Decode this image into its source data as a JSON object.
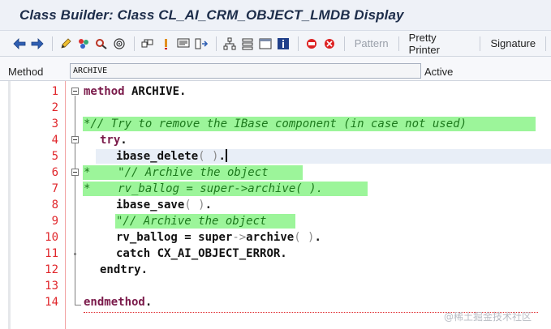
{
  "window": {
    "title": "Class Builder: Class CL_AI_CRM_OBJECT_LMDB Display"
  },
  "toolbar": {
    "buttons": [
      {
        "name": "back-icon"
      },
      {
        "name": "forward-icon"
      },
      {
        "name": "edit-pencil-icon"
      },
      {
        "name": "check-syntax-icon"
      },
      {
        "name": "activate-icon"
      },
      {
        "name": "where-used-icon"
      },
      {
        "name": "other-object-icon"
      },
      {
        "name": "test-icon"
      },
      {
        "name": "display-object-list-icon"
      },
      {
        "name": "navigate-icon"
      },
      {
        "name": "hierarchy-icon"
      },
      {
        "name": "stack-icon"
      },
      {
        "name": "window-icon"
      },
      {
        "name": "info-icon"
      },
      {
        "name": "insert-stop-icon"
      },
      {
        "name": "breakpoint-icon"
      }
    ],
    "pattern_label": "Pattern",
    "pretty_printer_label": "Pretty Printer",
    "signature_label": "Signature"
  },
  "method": {
    "label": "Method",
    "value": "ARCHIVE",
    "status": "Active"
  },
  "editor": {
    "line_numbers": [
      "1",
      "2",
      "3",
      "4",
      "5",
      "6",
      "7",
      "8",
      "9",
      "10",
      "11",
      "12",
      "13",
      "14"
    ],
    "lines": {
      "l1_kw": "method",
      "l1_rest": " ARCHIVE.",
      "l3": "*// Try to remove the IBase component (in case not used)",
      "l4_kw": "try",
      "l4_dot": ".",
      "l5_id": "ibase_delete",
      "l5_paren": "( )",
      "l5_dot": ".",
      "l6": "*    \"// Archive the object",
      "l7": "*    rv_ballog = super->archive( ).",
      "l8_id": "ibase_save",
      "l8_paren": "( )",
      "l8_dot": ".",
      "l9": "\"// Archive the object",
      "l10_a": "rv_ballog",
      "l10_eq": " = ",
      "l10_b": "super",
      "l10_arrow": "->",
      "l10_c": "archive",
      "l10_paren": "( )",
      "l10_dot": ".",
      "l11_kw": "catch",
      "l11_rest": " CX_AI_OBJECT_ERROR.",
      "l12_kw": "endtry",
      "l12_dot": ".",
      "l14_kw": "endmethod",
      "l14_dot": "."
    }
  },
  "watermark": "@稀土掘金技术社区",
  "colors": {
    "line_number": "#e0262b",
    "keyword": "#7a1a4a",
    "comment": "#1d7a1d",
    "comment_bg": "#9cf59a"
  }
}
